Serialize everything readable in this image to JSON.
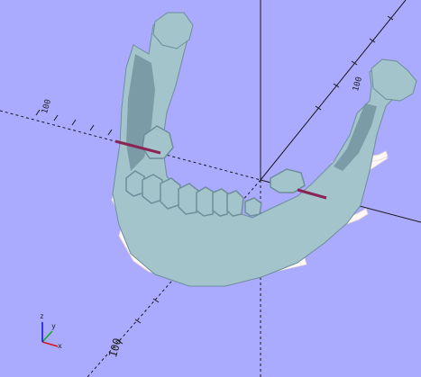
{
  "viewer": {
    "background_color": "#aaaaff",
    "model_color": "#a4c4cc",
    "model_shade_color": "#6d8f9a",
    "plate_color": "#fff8f6",
    "cut_line_color": "#8a2455",
    "axis_color": "#1a1a1a"
  },
  "axis_labels": {
    "y_negative": "100",
    "x_negative": "100",
    "x_negative_lower": "100",
    "y_positive": "100"
  },
  "axes_indicator": {
    "x_label": "x",
    "y_label": "y",
    "z_label": "z",
    "x_color": "#dd1111",
    "y_color": "#11aa11",
    "z_color": "#1111dd"
  }
}
